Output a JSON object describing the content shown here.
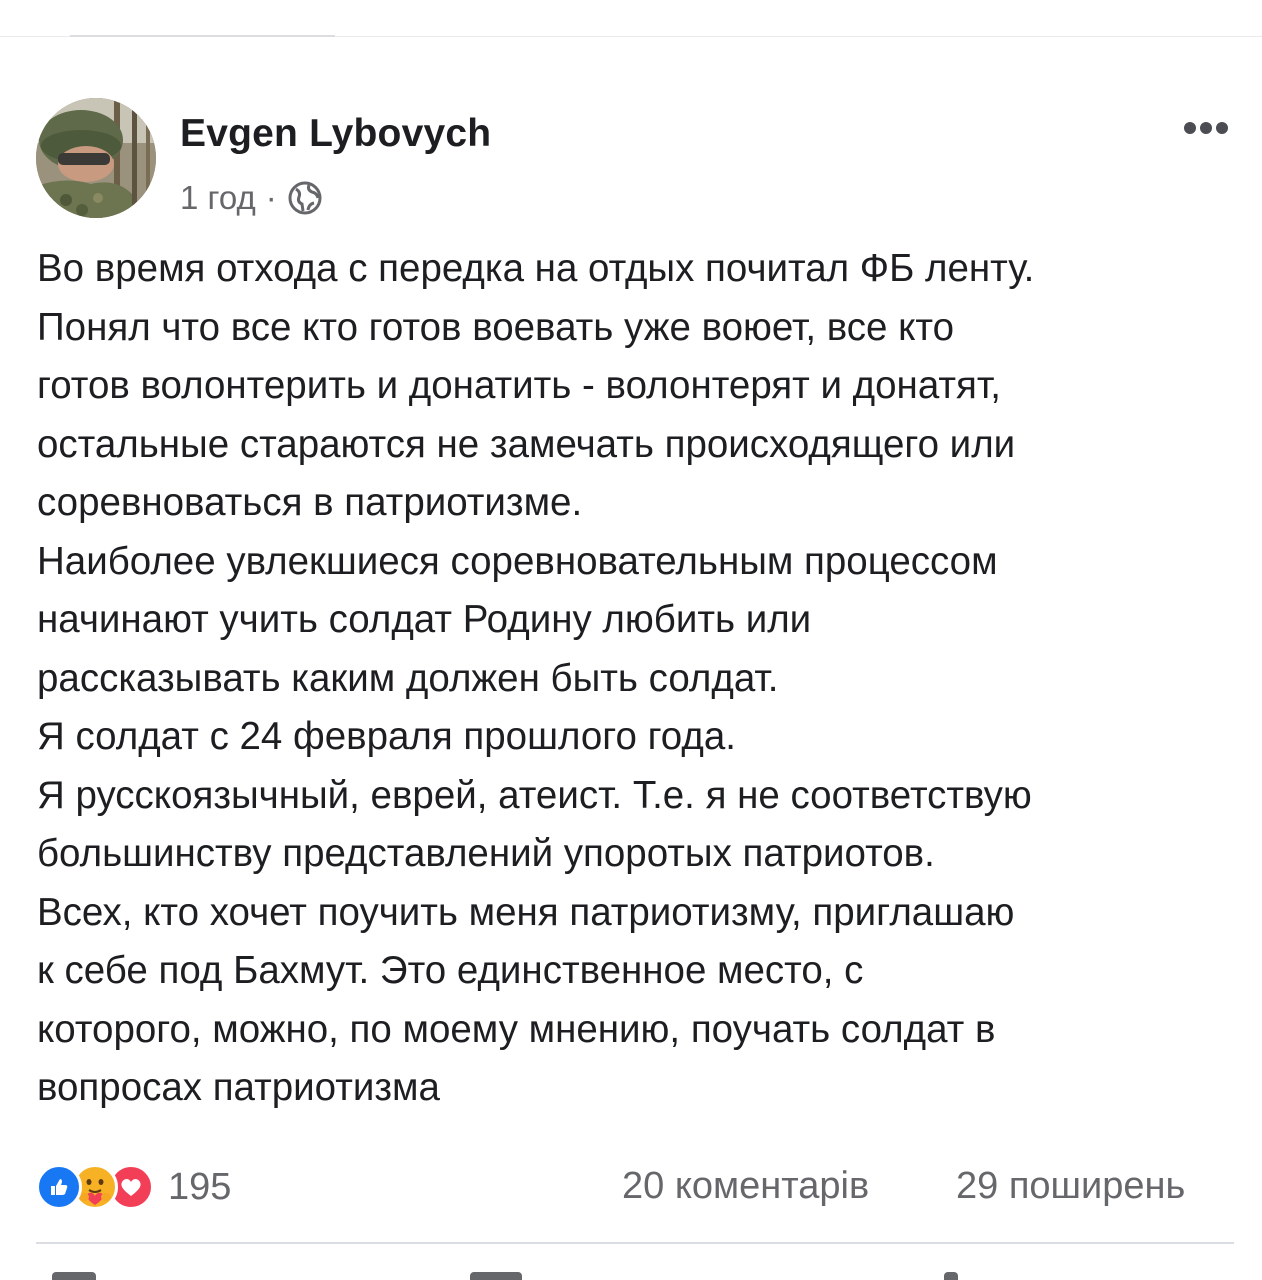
{
  "post": {
    "author": "Evgen Lybovych",
    "time": "1 год",
    "separator": "·",
    "privacy_icon": "globe-icon",
    "more_icon": "more-dots-icon",
    "lines": [
      "Во время отхода с передка на отдых почитал ФБ ленту.",
      "Понял что все кто готов воевать уже воюет, все кто",
      "готов волонтерить и донатить - волонтерят и донатят,",
      "остальные стараются не замечать происходящего или",
      "соревноваться в патриотизме.",
      "Наиболее увлекшиеся соревновательным процессом",
      "начинают учить солдат Родину любить или",
      "рассказывать каким должен быть солдат.",
      "Я солдат с 24 февраля прошлого года.",
      "Я русскоязычный, еврей, атеист. Т.е. я не соответствую",
      "большинству представлений упоротых патриотов.",
      "Всех, кто хочет поучить меня патриотизму, приглашаю",
      "к себе под Бахмут. Это единственное место, с",
      "которого, можно, по моему мнению, поучать солдат в",
      "вопросах патриотизма"
    ]
  },
  "footer": {
    "reaction_icons": [
      "like-icon",
      "care-icon",
      "love-icon"
    ],
    "reaction_count": "195",
    "comments": "20 коментарів",
    "shares": "29 поширень"
  },
  "colors": {
    "text": "#1c1e21",
    "secondary": "#65676b",
    "like": "#1877f2",
    "love": "#f33e58",
    "care": "#f7b125"
  }
}
